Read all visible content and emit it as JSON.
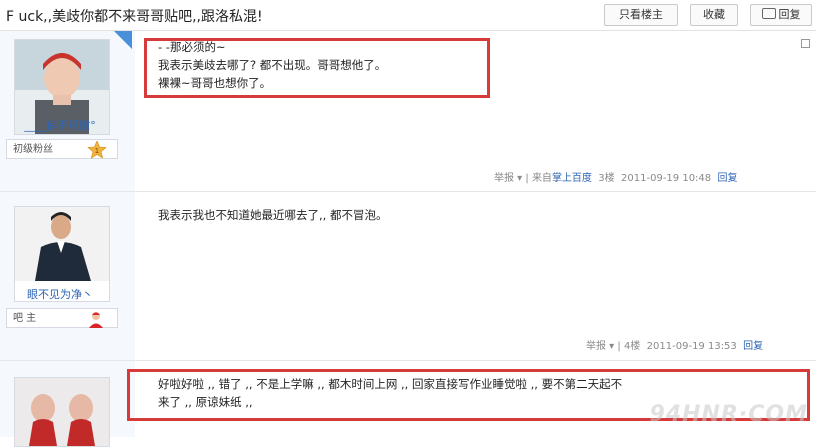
{
  "header": {
    "title": "F uck,,美歧你都不来哥哥贴吧,,跟洛私混!",
    "buttons": {
      "only_author": "只看楼主",
      "favorite": "收藏",
      "reply": "回复"
    }
  },
  "posts": [
    {
      "username": "____俏不可耐°",
      "badge": "初级粉丝",
      "badge_level": "1",
      "lines": [
        "- -那必须的~",
        "我表示美歧去哪了? 都不出现。哥哥想他了。",
        "裸裸~哥哥也想你了。"
      ],
      "meta": {
        "report": "举报",
        "source_prefix": "来自",
        "source": "掌上百度",
        "floor": "3楼",
        "time": "2011-09-19 10:48",
        "reply": "回复"
      }
    },
    {
      "username": "眼不见为净丶",
      "badge": "吧 主",
      "lines": [
        "我表示我也不知道她最近哪去了,, 都不冒泡。"
      ],
      "meta": {
        "report": "举报",
        "floor": "4楼",
        "time": "2011-09-19 13:53",
        "reply": "回复"
      }
    },
    {
      "lines": [
        "好啦好啦 ,, 错了 ,, 不是上学嘛 ,,   都木时间上网 ,, 回家直接写作业睡觉啦 ,, 要不第二天起不",
        "来了 ,, 原谅妹纸 ,,"
      ]
    }
  ],
  "watermark": "94HNR·COM",
  "colors": {
    "highlight_box": "#d63a3a",
    "link": "#2d64b3",
    "sidebar_bg": "#f5f8fc"
  }
}
